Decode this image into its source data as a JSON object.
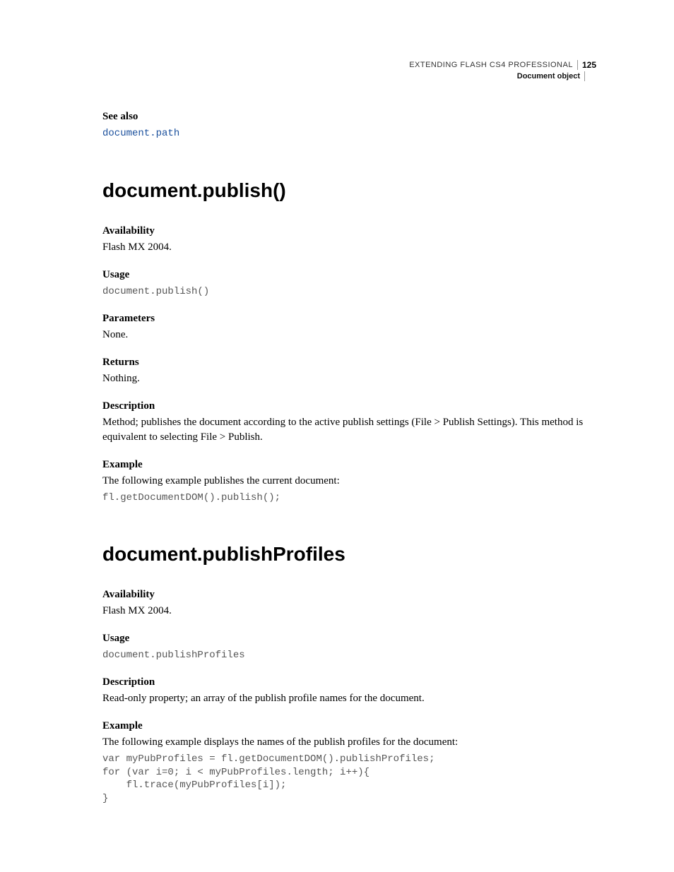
{
  "header": {
    "book_title": "EXTENDING FLASH CS4 PROFESSIONAL",
    "page_number": "125",
    "chapter": "Document object"
  },
  "see_also": {
    "label": "See also",
    "link": "document.path"
  },
  "sections": [
    {
      "title": "document.publish()",
      "availability": {
        "label": "Availability",
        "text": "Flash MX 2004."
      },
      "usage": {
        "label": "Usage",
        "code": "document.publish()"
      },
      "parameters": {
        "label": "Parameters",
        "text": "None."
      },
      "returns": {
        "label": "Returns",
        "text": "Nothing."
      },
      "description": {
        "label": "Description",
        "text": "Method; publishes the document according to the active publish settings (File > Publish Settings). This method is equivalent to selecting File > Publish."
      },
      "example": {
        "label": "Example",
        "intro": "The following example publishes the current document:",
        "code": "fl.getDocumentDOM().publish();"
      }
    },
    {
      "title": "document.publishProfiles",
      "availability": {
        "label": "Availability",
        "text": "Flash MX 2004."
      },
      "usage": {
        "label": "Usage",
        "code": "document.publishProfiles"
      },
      "description": {
        "label": "Description",
        "text": "Read-only property; an array of the publish profile names for the document."
      },
      "example": {
        "label": "Example",
        "intro": "The following example displays the names of the publish profiles for the document:",
        "code": "var myPubProfiles = fl.getDocumentDOM().publishProfiles; \nfor (var i=0; i < myPubProfiles.length; i++){ \n    fl.trace(myPubProfiles[i]); \n}"
      }
    }
  ]
}
